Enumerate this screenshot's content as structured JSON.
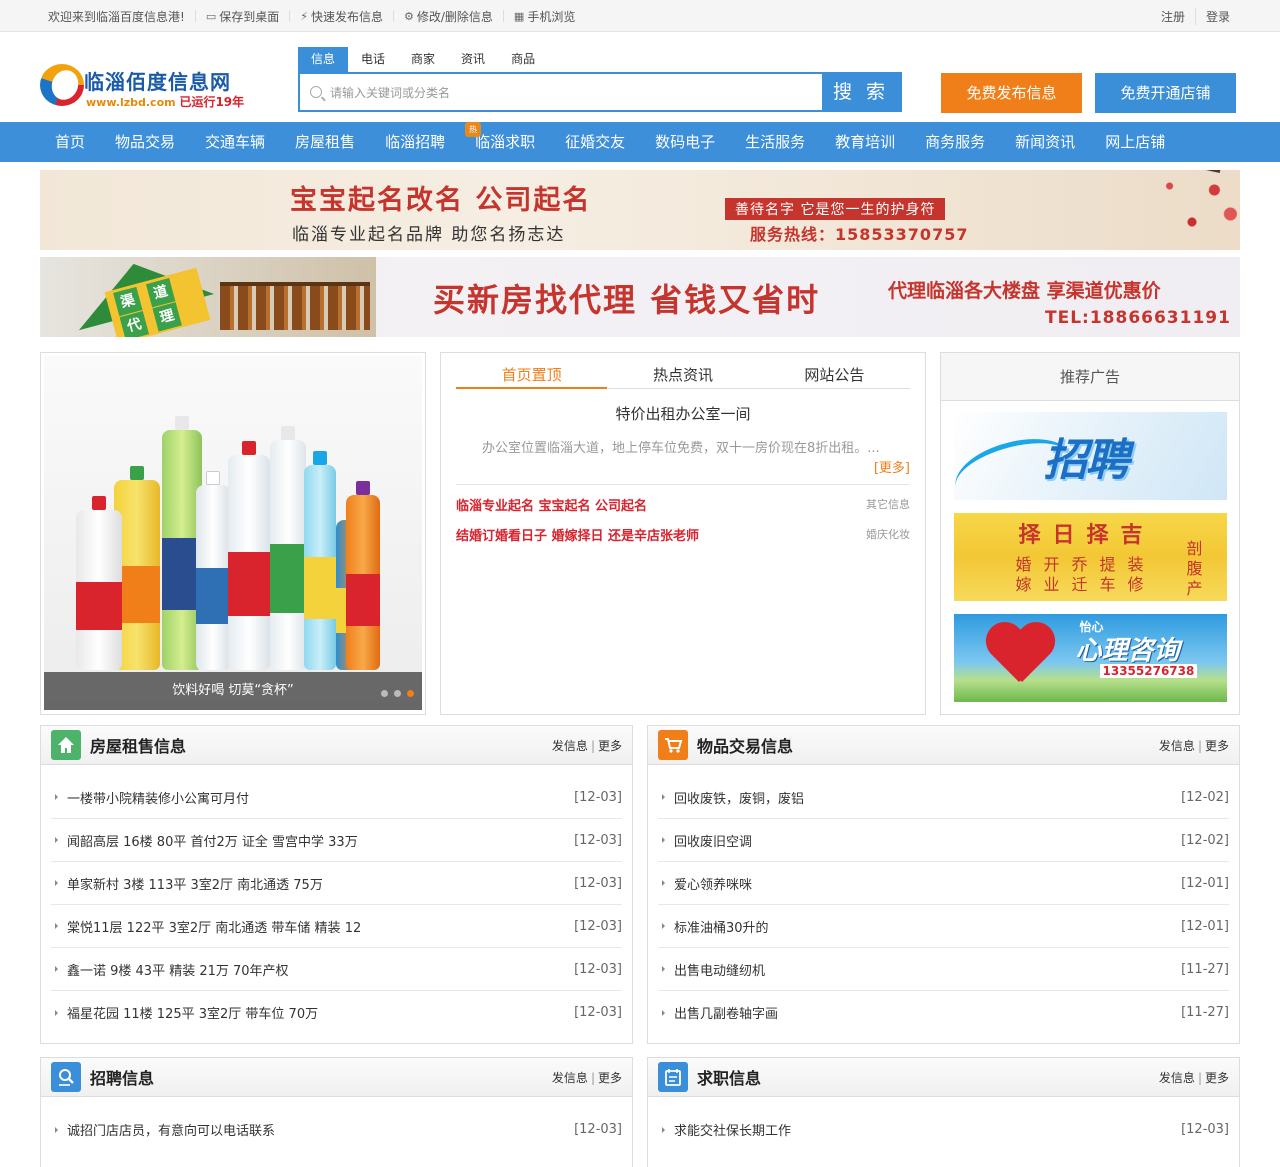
{
  "topbar": {
    "welcome": "欢迎来到临淄百度信息港!",
    "links": [
      {
        "icon": "monitor-icon",
        "glyph": "▭",
        "label": "保存到桌面"
      },
      {
        "icon": "lightning-icon",
        "glyph": "⚡",
        "label": "快速发布信息"
      },
      {
        "icon": "gear-icon",
        "glyph": "⚙",
        "label": "修改/删除信息"
      },
      {
        "icon": "qrcode-icon",
        "glyph": "▦",
        "label": "手机浏览"
      }
    ],
    "register": "注册",
    "login": "登录"
  },
  "logo": {
    "title": "临淄佰度信息网",
    "url": "www.lzbd.com",
    "running": "已运行19年"
  },
  "search": {
    "tabs": [
      "信息",
      "电话",
      "商家",
      "资讯",
      "商品"
    ],
    "active_tab": 0,
    "placeholder": "请输入关键词或分类名",
    "button": "搜 索",
    "hot_badge": "热"
  },
  "header_buttons": {
    "publish": "免费发布信息",
    "open_store": "免费开通店铺"
  },
  "nav": [
    "首页",
    "物品交易",
    "交通车辆",
    "房屋租售",
    "临淄招聘",
    "临淄求职",
    "征婚交友",
    "数码电子",
    "生活服务",
    "教育培训",
    "商务服务",
    "新闻资讯",
    "网上店铺"
  ],
  "banner1": {
    "line1": "宝宝起名改名 公司起名",
    "line2": "临淄专业起名品牌 助您名扬志达",
    "slogan": "善待名字 它是您一生的护身符",
    "hotline": "服务热线：15853370757"
  },
  "banner2": {
    "sign_chars": [
      "渠",
      "道",
      "代",
      "理"
    ],
    "headline": "买新房找代理 省钱又省时",
    "subline": "代理临淄各大楼盘 享渠道优惠价",
    "tel": "TEL:18866631191"
  },
  "slider": {
    "caption": "饮料好喝 切莫“贪杯”",
    "dots": 3,
    "active_dot": 2
  },
  "news": {
    "tabs": [
      "首页置顶",
      "热点资讯",
      "网站公告"
    ],
    "active_tab": 0,
    "headline": "特价出租办公室一间",
    "desc": "办公室位置临淄大道，地上停车位免费，双十一房价现在8折出租。...",
    "more": "[更多]",
    "items": [
      {
        "title": "临淄专业起名 宝宝起名 公司起名",
        "category": "其它信息"
      },
      {
        "title": "结婚订婚看日子 婚嫁择日 还是辛店张老师",
        "category": "婚庆化妆"
      }
    ]
  },
  "recommend": {
    "title": "推荐广告",
    "ad1_text": "招聘",
    "ad2_title": "择日择吉",
    "ad2_body": "婚开乔提装嫁业迁车修",
    "ad2_side": "剖腹产",
    "ad3_small": "怡心",
    "ad3_big": "心理咨询",
    "ad3_phone": "13355276738"
  },
  "boxes": [
    {
      "icon": "house-icon",
      "color": "#4db36b",
      "title": "房屋租售信息",
      "post": "发信息",
      "more": "更多",
      "items": [
        {
          "title": "一楼带小院精装修小公寓可月付",
          "date": "[12-03]"
        },
        {
          "title": "闻韶高层 16楼 80平 首付2万 证全 雪宫中学 33万",
          "date": "[12-03]"
        },
        {
          "title": "单家新村 3楼 113平 3室2厅 南北通透 75万",
          "date": "[12-03]"
        },
        {
          "title": "棠悦11层 122平 3室2厅 南北通透 带车储 精装 12",
          "date": "[12-03]"
        },
        {
          "title": "鑫一诺 9楼 43平 精装 21万 70年产权",
          "date": "[12-03]"
        },
        {
          "title": "福星花园 11楼 125平 3室2厅 带车位 70万",
          "date": "[12-03]"
        }
      ]
    },
    {
      "icon": "cart-icon",
      "color": "#f07f1a",
      "title": "物品交易信息",
      "post": "发信息",
      "more": "更多",
      "items": [
        {
          "title": "回收废铁，废铜，废铝",
          "date": "[12-02]"
        },
        {
          "title": "回收废旧空调",
          "date": "[12-02]"
        },
        {
          "title": "爱心领养咪咪",
          "date": "[12-01]"
        },
        {
          "title": "标准油桶30升的",
          "date": "[12-01]"
        },
        {
          "title": "出售电动缝纫机",
          "date": "[11-27]"
        },
        {
          "title": "出售几副卷轴字画",
          "date": "[11-27]"
        }
      ]
    },
    {
      "icon": "search-person-icon",
      "color": "#3b8ed8",
      "title": "招聘信息",
      "post": "发信息",
      "more": "更多",
      "items": [
        {
          "title": "诚招门店店员，有意向可以电话联系",
          "date": "[12-03]"
        }
      ]
    },
    {
      "icon": "calendar-icon",
      "color": "#3b8ed8",
      "title": "求职信息",
      "post": "发信息",
      "more": "更多",
      "items": [
        {
          "title": "求能交社保长期工作",
          "date": "[12-03]"
        }
      ]
    }
  ]
}
